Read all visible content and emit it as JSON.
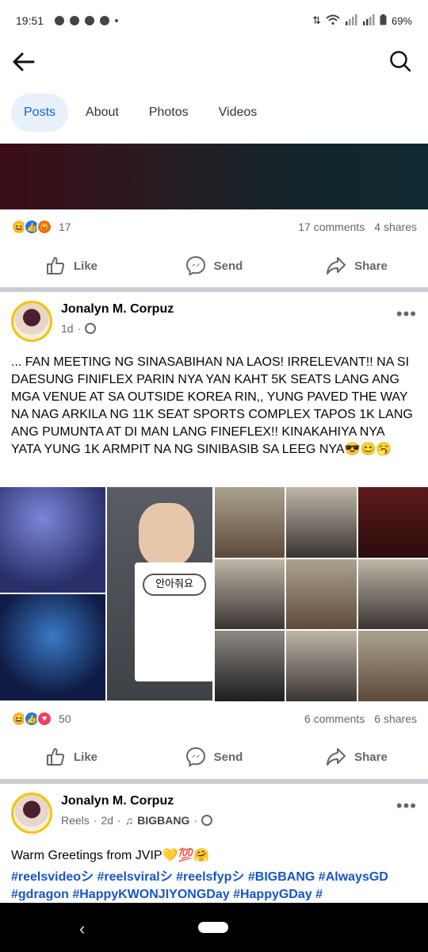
{
  "status_bar": {
    "time": "19:51",
    "battery": "69%"
  },
  "header": {
    "back_icon": "arrow-left-icon",
    "search_icon": "search-icon"
  },
  "tabs": [
    {
      "label": "Posts",
      "active": true
    },
    {
      "label": "About",
      "active": false
    },
    {
      "label": "Photos",
      "active": false
    },
    {
      "label": "Videos",
      "active": false
    }
  ],
  "post1": {
    "reaction_count": "17",
    "comments": "17 comments",
    "shares": "4 shares"
  },
  "actions": {
    "like": "Like",
    "send": "Send",
    "share": "Share"
  },
  "post2": {
    "author": "Jonalyn M. Corpuz",
    "time": "1d",
    "text": "... FAN MEETING NG SINASABIHAN NA LAOS! IRRELEVANT!! NA SI DAESUNG  FINIFLEX PARIN NYA YAN KAHT 5K SEATS LANG ANG MGA VENUE AT SA OUTSIDE KOREA RIN,, YUNG PAVED THE WAY NA NAG ARKILA NG 11K SEAT SPORTS COMPLEX TAPOS 1K LANG ANG PUMUNTA AT DI MAN LANG FINEFLEX!! KINAKAHIYA NYA YATA YUNG 1K ARMPIT NA NG SINIBASIB SA LEEG NYA😎😊🥱",
    "reaction_count": "50",
    "comments": "6 comments",
    "shares": "6 shares",
    "card_text": "안아줘요"
  },
  "post3": {
    "author": "Jonalyn M. Corpuz",
    "type": "Reels",
    "time": "2d",
    "music": "BIGBANG",
    "text": "Warm Greetings from JVIP💛💯🤗",
    "hashtags": [
      "#reelsvideoシ",
      "#reelsviralシ",
      "#reelsfypシ",
      "#BIGBANG",
      "#AlwaysGD",
      "#gdragon",
      "#HappyKWONJIYONGDay",
      "#HappyGDay",
      "#"
    ]
  }
}
